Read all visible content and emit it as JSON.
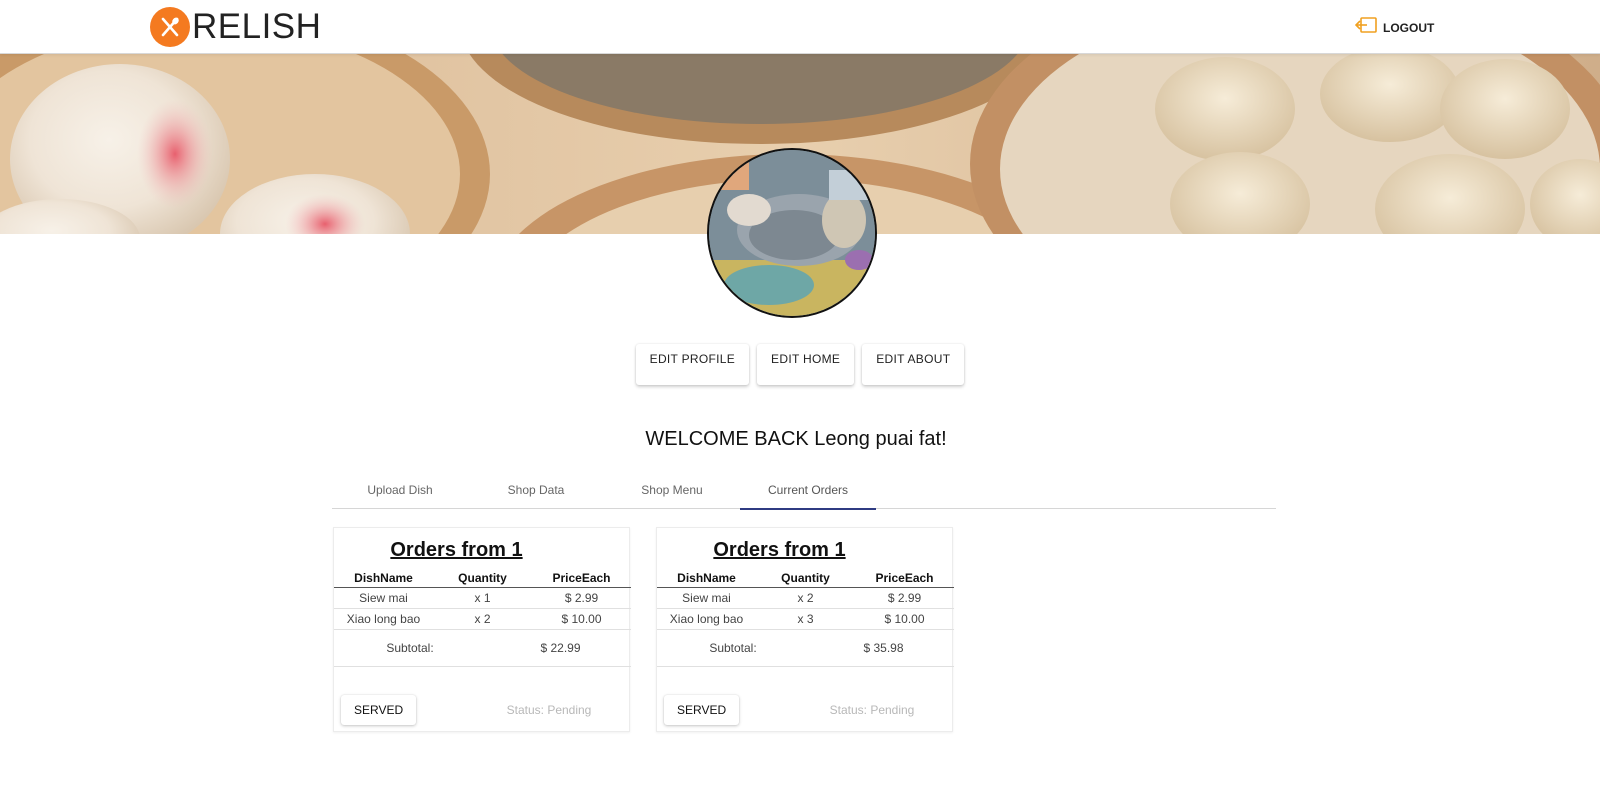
{
  "header": {
    "brand_name": "RELISH",
    "brand_icon": "fork-knife-icon",
    "logout_label": "LOGOUT",
    "logout_icon": "logout-icon",
    "accent_color": "#f47a20"
  },
  "edit_buttons": {
    "profile": "EDIT PROFILE",
    "home": "EDIT HOME",
    "about": "EDIT ABOUT"
  },
  "welcome": "WELCOME BACK Leong puai fat!",
  "tabs": [
    {
      "label": "Upload Dish",
      "active": false
    },
    {
      "label": "Shop Data",
      "active": false
    },
    {
      "label": "Shop Menu",
      "active": false
    },
    {
      "label": "Current Orders",
      "active": true
    }
  ],
  "orders": [
    {
      "title": "Orders from 1",
      "headers": [
        "DishName",
        "Quantity",
        "PriceEach"
      ],
      "rows": [
        [
          "Siew mai",
          "x 1",
          "$ 2.99"
        ],
        [
          "Xiao long bao",
          "x 2",
          "$ 10.00"
        ]
      ],
      "subtotal_label": "Subtotal:",
      "subtotal_value": "$ 22.99",
      "served_label": "SERVED",
      "status": "Status: Pending"
    },
    {
      "title": "Orders from 1",
      "headers": [
        "DishName",
        "Quantity",
        "PriceEach"
      ],
      "rows": [
        [
          "Siew mai",
          "x 2",
          "$ 2.99"
        ],
        [
          "Xiao long bao",
          "x 3",
          "$ 10.00"
        ]
      ],
      "subtotal_label": "Subtotal:",
      "subtotal_value": "$ 35.98",
      "served_label": "SERVED",
      "status": "Status: Pending"
    }
  ]
}
